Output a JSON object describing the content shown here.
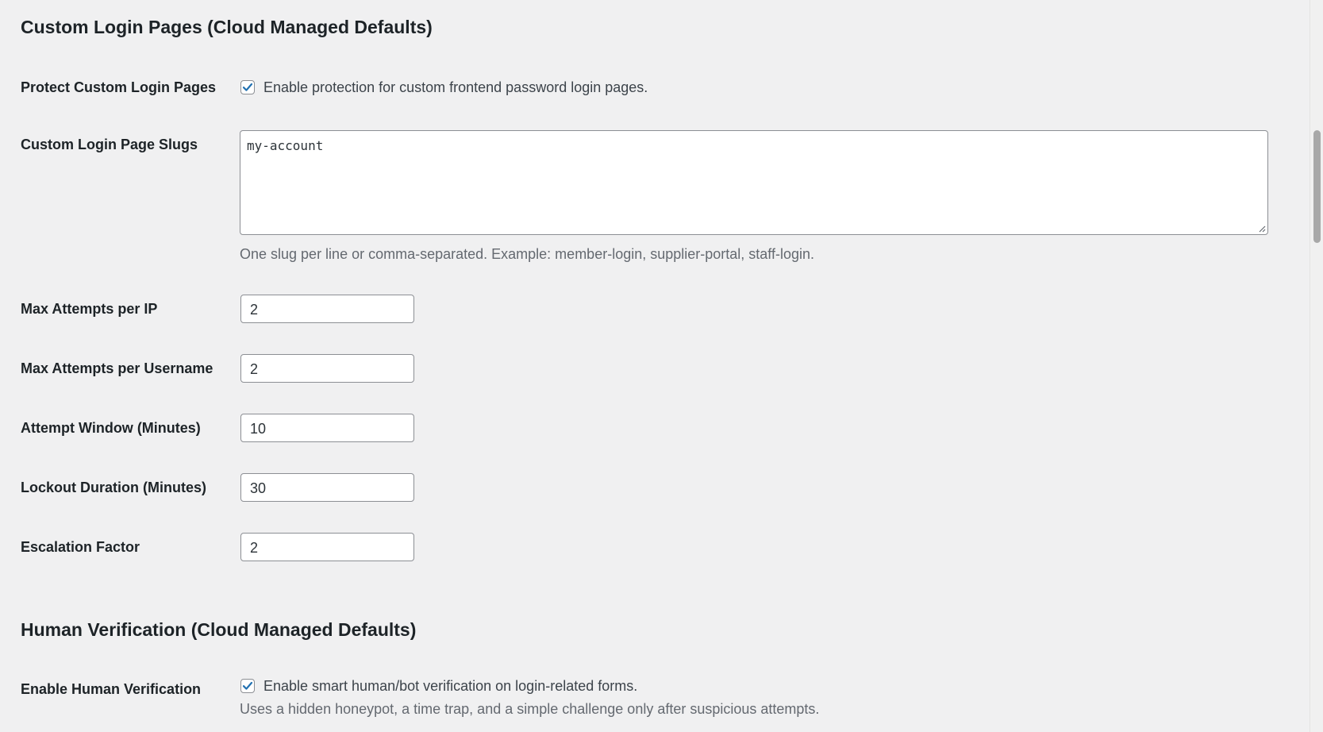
{
  "custom_login": {
    "section_title": "Custom Login Pages (Cloud Managed Defaults)",
    "protect": {
      "label": "Protect Custom Login Pages",
      "checked": true,
      "checkbox_label": "Enable protection for custom frontend password login pages."
    },
    "slugs": {
      "label": "Custom Login Page Slugs",
      "value": "my-account",
      "description": "One slug per line or comma-separated. Example: member-login, supplier-portal, staff-login."
    },
    "max_attempts_ip": {
      "label": "Max Attempts per IP",
      "value": "2"
    },
    "max_attempts_username": {
      "label": "Max Attempts per Username",
      "value": "2"
    },
    "attempt_window": {
      "label": "Attempt Window (Minutes)",
      "value": "10"
    },
    "lockout_duration": {
      "label": "Lockout Duration (Minutes)",
      "value": "30"
    },
    "escalation_factor": {
      "label": "Escalation Factor",
      "value": "2"
    }
  },
  "human_verification": {
    "section_title": "Human Verification (Cloud Managed Defaults)",
    "enable": {
      "label": "Enable Human Verification",
      "checked": true,
      "checkbox_label": "Enable smart human/bot verification on login-related forms.",
      "description": "Uses a hidden honeypot, a time trap, and a simple challenge only after suspicious attempts."
    }
  },
  "colors": {
    "background": "#f0f0f1",
    "checkmark": "#2271b1",
    "input_border": "#8c8f94",
    "description_text": "#646970"
  },
  "icons": {
    "checkbox_check": "checkmark-icon",
    "textarea_resize": "resize-grip-icon"
  }
}
